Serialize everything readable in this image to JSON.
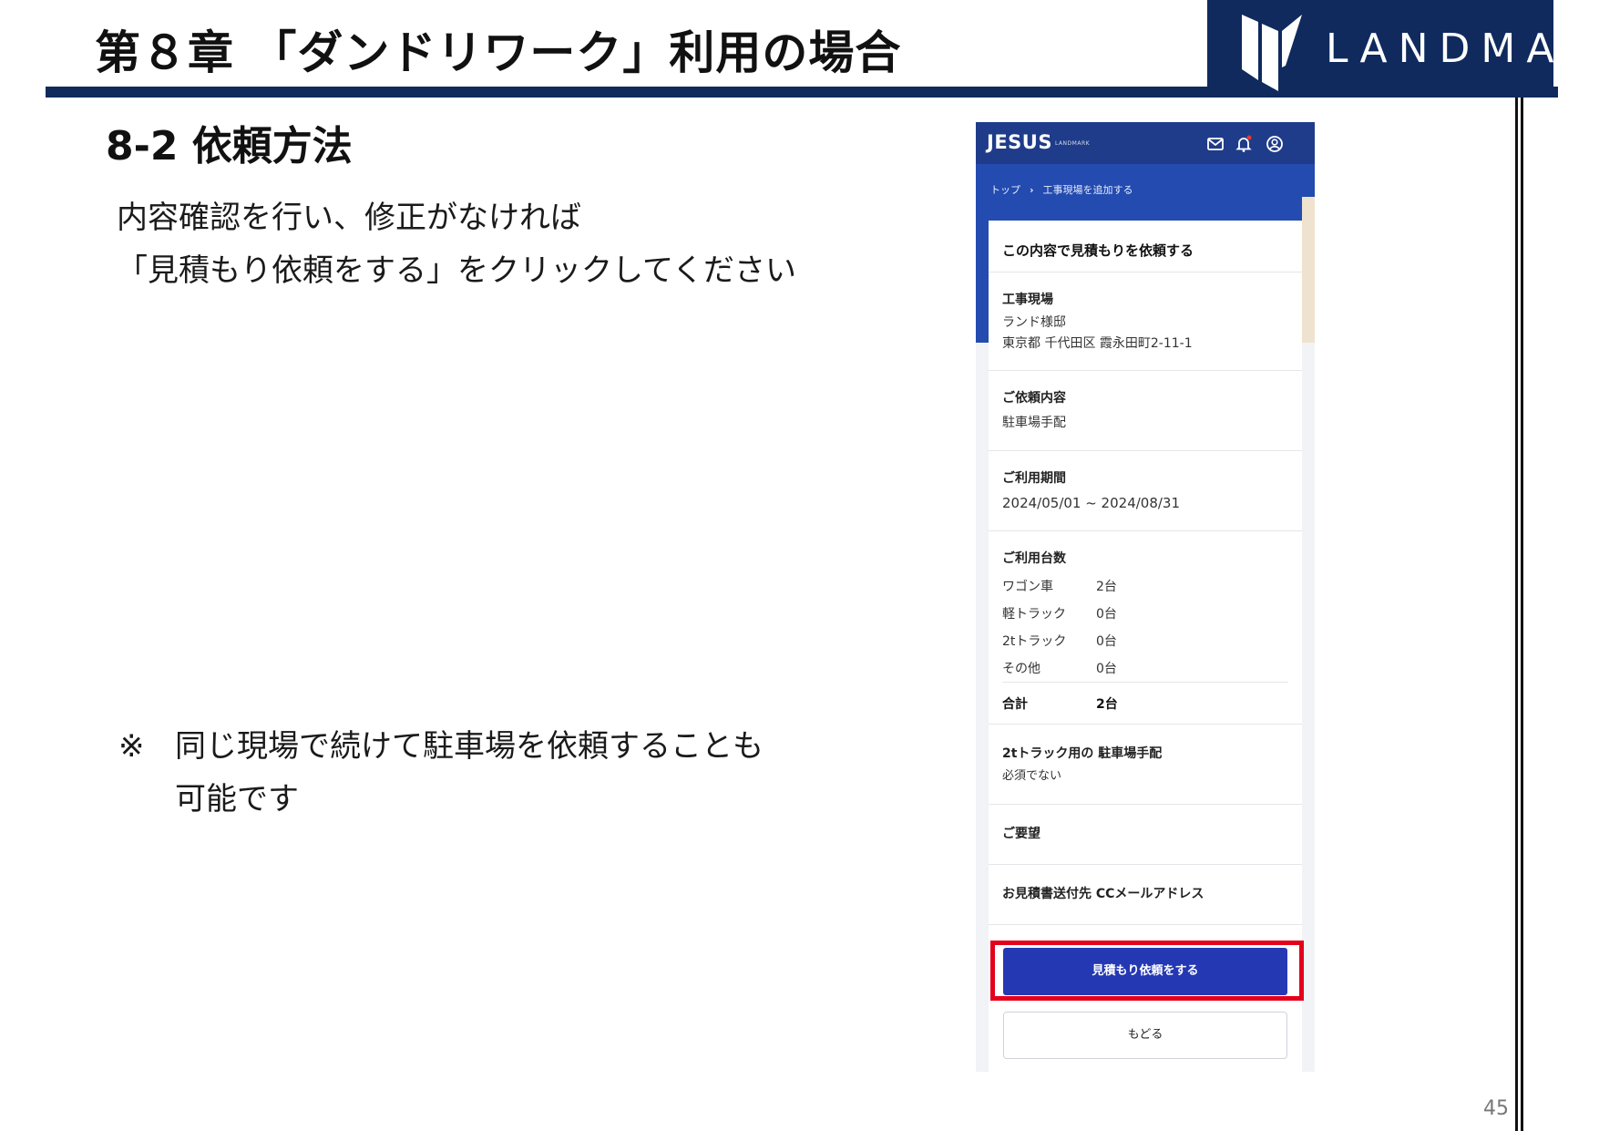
{
  "slide": {
    "chapter_title": "第８章 「ダンドリワーク」利用の場合",
    "section_title": "8-2  依頼方法",
    "instructions": [
      "内容確認を行い、修正がなければ",
      "「見積もり依頼をする」をクリックしてください"
    ],
    "note_mark": "※",
    "note_lines": [
      "同じ現場で続けて駐車場を依頼することも",
      "可能です"
    ],
    "page_number": "45"
  },
  "logo": {
    "text": "LANDMARK",
    "icon": "landmark-logo-icon"
  },
  "colors": {
    "navy": "#102a5e",
    "app_header": "#1f3c8a",
    "app_band": "#234bb0",
    "primary_button": "#2438b4",
    "highlight_red": "#e4001b"
  },
  "app": {
    "brand": "JESUS",
    "brand_sub": "LANDMARK",
    "header_icons": [
      "mail-icon",
      "bell-icon",
      "account-icon"
    ],
    "breadcrumb": [
      "トップ",
      "工事現場を追加する"
    ],
    "form": {
      "title": "この内容で見積もりを依頼する",
      "site": {
        "label": "工事現場",
        "name": "ランド様邸",
        "address": "東京都 千代田区 霞永田町2-11-1"
      },
      "request": {
        "label": "ご依頼内容",
        "value": "駐車場手配"
      },
      "period": {
        "label": "ご利用期間",
        "value": "2024/05/01 ~ 2024/08/31"
      },
      "vehicles": {
        "label": "ご利用台数",
        "rows": [
          {
            "name": "ワゴン車",
            "count": "2台"
          },
          {
            "name": "軽トラック",
            "count": "0台"
          },
          {
            "name": "2tトラック",
            "count": "0台"
          },
          {
            "name": "その他",
            "count": "0台"
          }
        ],
        "total_label": "合計",
        "total_count": "2台"
      },
      "truck_parking": {
        "label": "2tトラック用の 駐車場手配",
        "value": "必須でない"
      },
      "request_note": {
        "label": "ご要望",
        "value": ""
      },
      "cc_email": {
        "label": "お見積書送付先 CCメールアドレス",
        "value": ""
      },
      "submit_label": "見積もり依頼をする",
      "back_label": "もどる"
    }
  }
}
